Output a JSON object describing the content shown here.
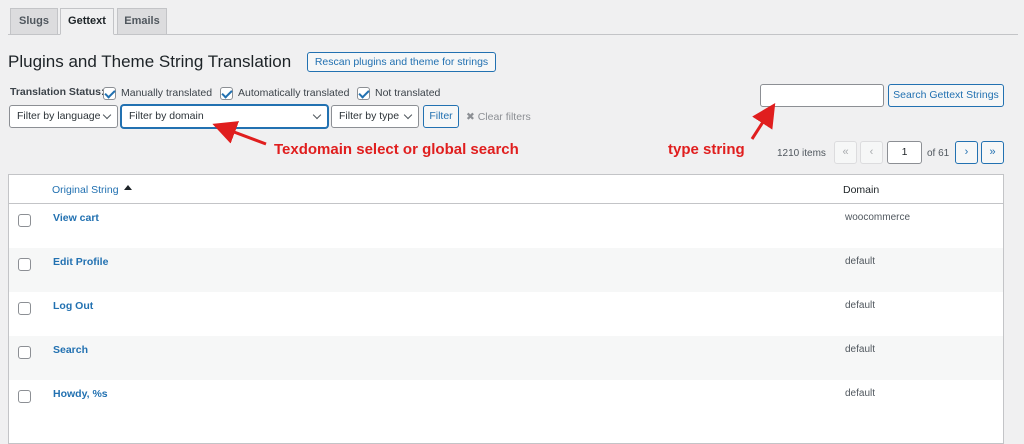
{
  "tabs": [
    {
      "label": "Slugs"
    },
    {
      "label": "Gettext"
    },
    {
      "label": "Emails"
    }
  ],
  "page_title": "Plugins and Theme String Translation",
  "rescan_button": "Rescan plugins and theme for strings",
  "translation_status": {
    "label": "Translation Status:",
    "options": [
      {
        "label": "Manually translated",
        "checked": true
      },
      {
        "label": "Automatically translated",
        "checked": true
      },
      {
        "label": "Not translated",
        "checked": true
      }
    ]
  },
  "filters": {
    "language": "Filter by language",
    "domain": "Filter by domain",
    "type": "Filter by type",
    "filter_button": "Filter",
    "clear_filters": "✖ Clear filters"
  },
  "search": {
    "value": "",
    "button": "Search Gettext Strings"
  },
  "annotations": {
    "domain_note": "Texdomain select or global search",
    "search_note": "type string"
  },
  "pagination": {
    "items": "1210 items",
    "first": "«",
    "prev": "‹",
    "current_page": "1",
    "of": "of 61",
    "next": "›",
    "last": "»"
  },
  "table": {
    "columns": {
      "original": "Original String",
      "domain": "Domain"
    },
    "rows": [
      {
        "string": "View cart",
        "domain": "woocommerce"
      },
      {
        "string": "Edit Profile",
        "domain": "default"
      },
      {
        "string": "Log Out",
        "domain": "default"
      },
      {
        "string": "Search",
        "domain": "default"
      },
      {
        "string": "Howdy, %s",
        "domain": "default"
      }
    ]
  },
  "colors": {
    "accent": "#2271b1",
    "annotation": "#e01e1e"
  }
}
